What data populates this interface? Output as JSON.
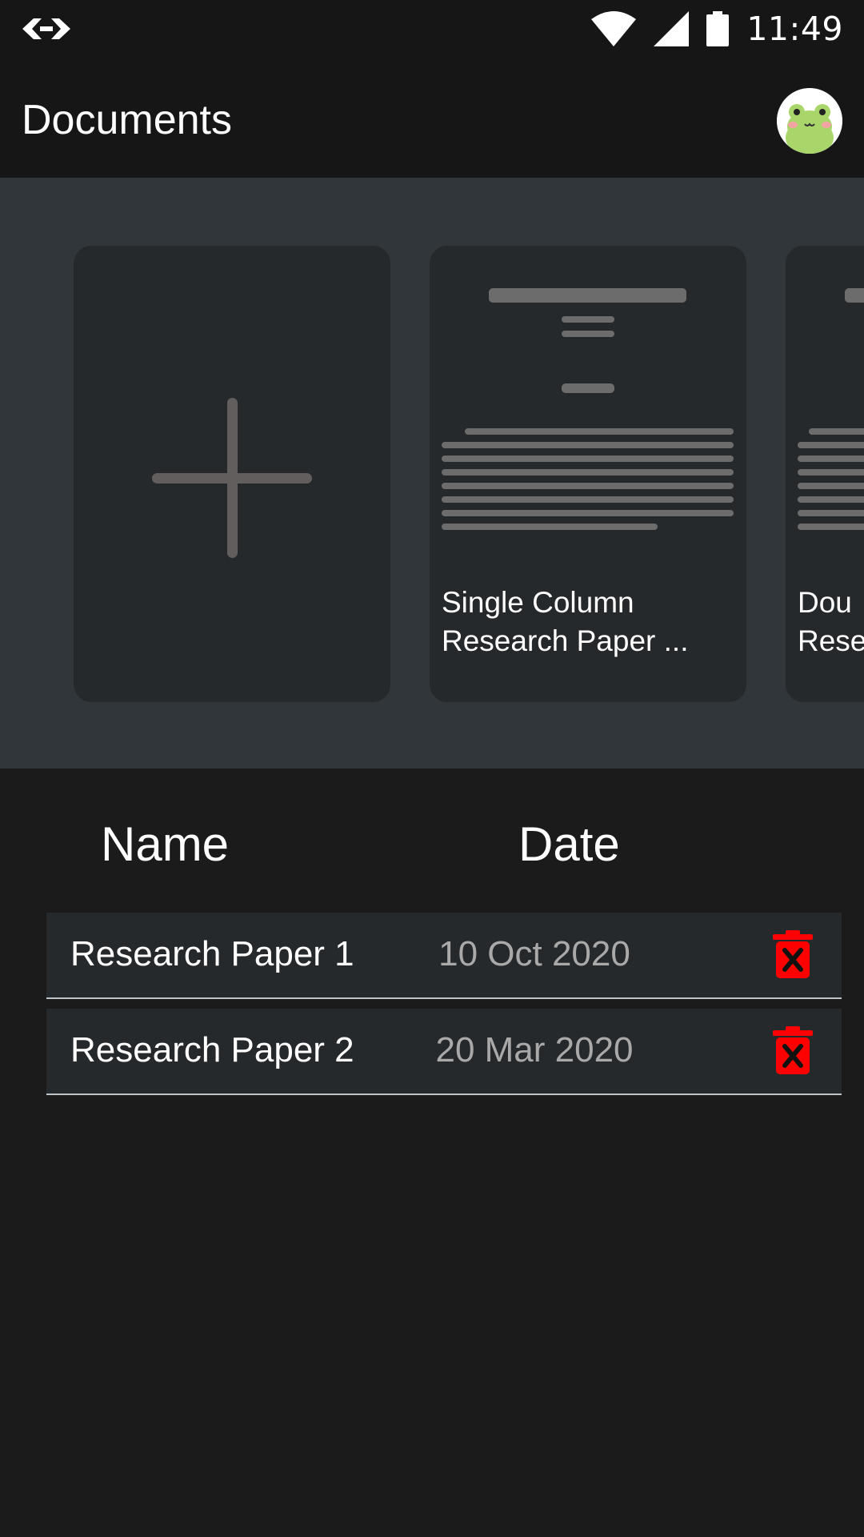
{
  "status_bar": {
    "time": "11:49",
    "icons": [
      "code-icon",
      "wifi-icon",
      "cellular-signal-icon",
      "battery-icon"
    ]
  },
  "app_bar": {
    "title": "Documents",
    "avatar_icon": "frog-avatar-icon"
  },
  "templates": [
    {
      "kind": "new",
      "icon": "plus-icon"
    },
    {
      "kind": "template",
      "label_line1": "Single Column",
      "label_line2": "Research Paper ..."
    },
    {
      "kind": "template",
      "label_line1": "Dou",
      "label_line2": "Rese"
    }
  ],
  "list": {
    "headers": {
      "name": "Name",
      "date": "Date"
    },
    "rows": [
      {
        "name": "Research Paper 1",
        "date": "10 Oct 2020",
        "action_icon": "delete-icon"
      },
      {
        "name": "Research Paper 2",
        "date": "20 Mar 2020",
        "action_icon": "delete-icon"
      }
    ]
  },
  "colors": {
    "background": "#1b1b1b",
    "bar": "#161616",
    "template_strip": "#31363a",
    "card": "#26292c",
    "delete": "#ff0000",
    "date_text": "#a9a9a9"
  }
}
